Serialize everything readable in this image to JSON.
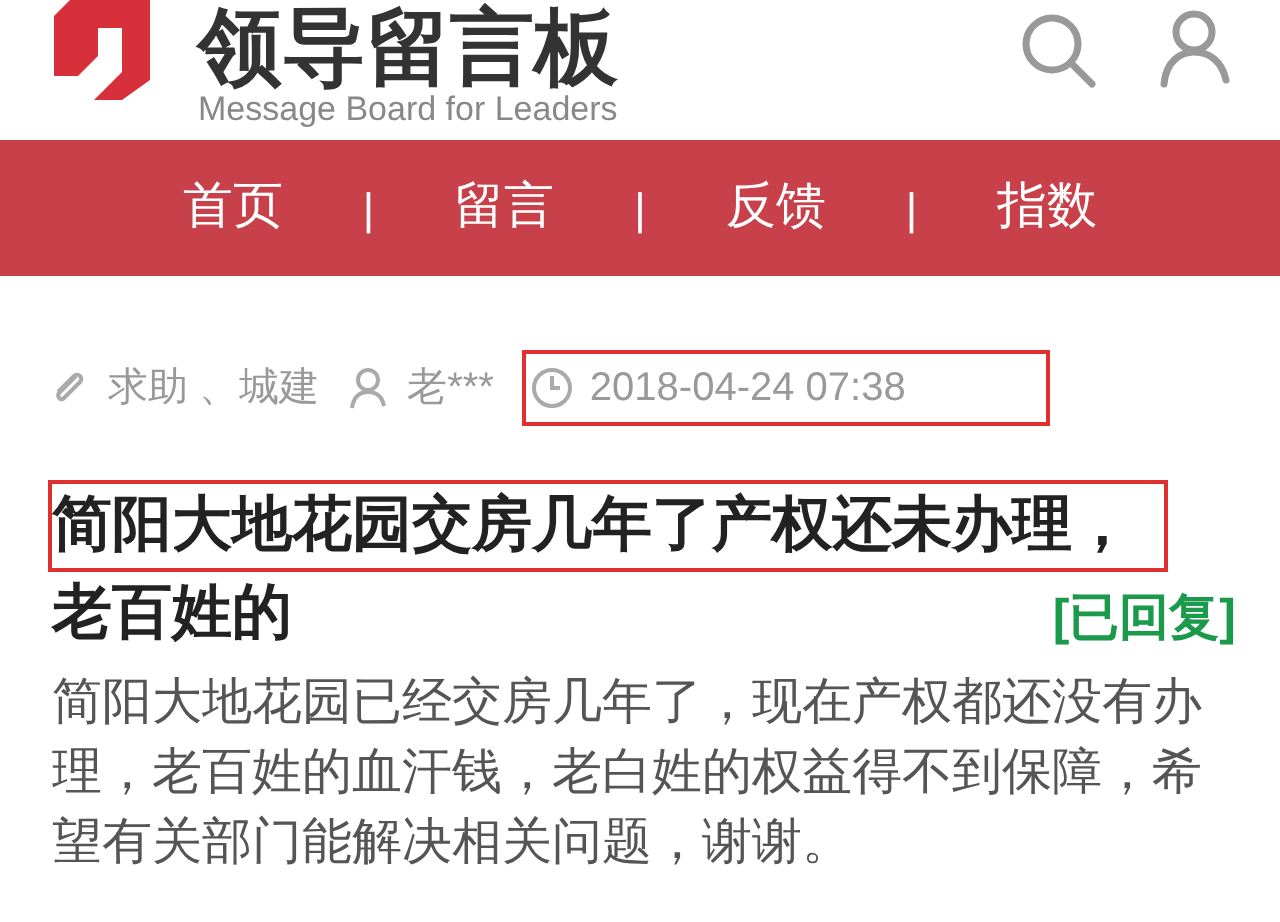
{
  "header": {
    "title": "领导留言板",
    "subtitle": "Message Board for Leaders"
  },
  "nav": [
    {
      "label": "首页"
    },
    {
      "label": "留言"
    },
    {
      "label": "反馈"
    },
    {
      "label": "指数"
    }
  ],
  "nav_separator": "|",
  "post": {
    "category": "求助 、城建",
    "author": "老***",
    "time": "2018-04-24 07:38",
    "time_highlighted": true,
    "title_lines": [
      {
        "text": "简阳大地花园交房几年了产权还未办理，",
        "highlighted": true
      },
      {
        "text": "老百姓的",
        "highlighted": false
      }
    ],
    "status": "[已回复]",
    "body": "简阳大地花园已经交房几年了，现在产权都还没有办理，老百姓的血汗钱，老白姓的权益得不到保障，希望有关部门能解决相关问题，谢谢。"
  }
}
